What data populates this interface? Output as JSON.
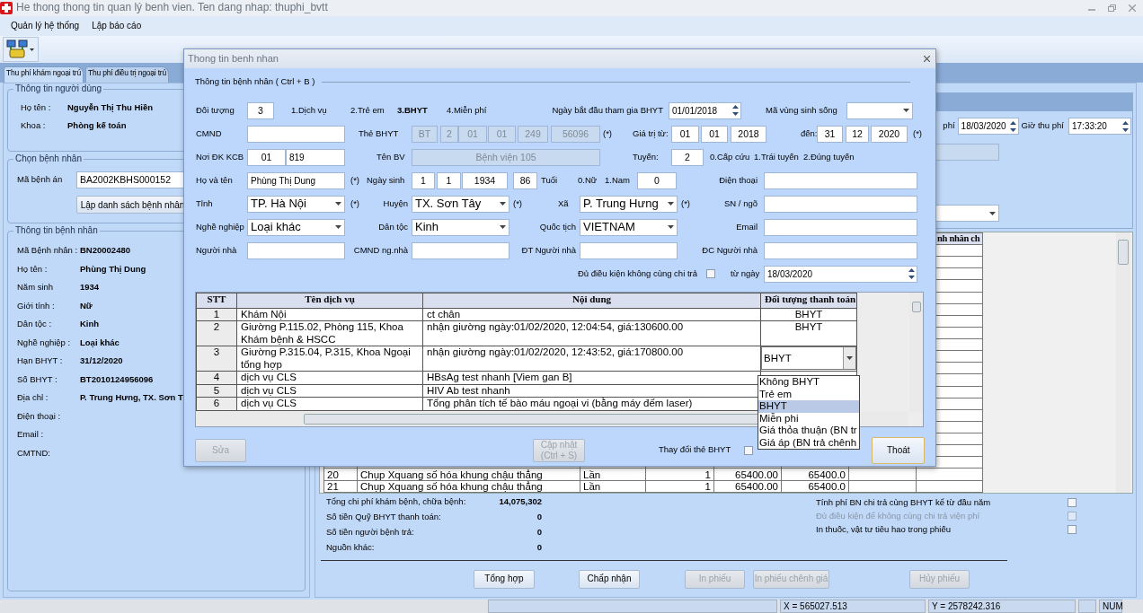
{
  "window": {
    "title": "He thong thong tin quan lý benh vien. Ten dang nhap: thuphi_bvtt"
  },
  "menu": [
    {
      "label": "Quản lý hệ thống"
    },
    {
      "label": "Lập báo cáo"
    }
  ],
  "tabs": [
    {
      "label": "Thu phí khám ngoại trú",
      "selected": true
    },
    {
      "label": "Thu phí điều trị ngoại trú",
      "selected": false
    }
  ],
  "user_info": {
    "title": "Thông tin người dùng",
    "fields": [
      {
        "label": "Họ tên :",
        "value": "Nguyễn Thị Thu Hiền"
      },
      {
        "label": "Khoa :",
        "value": "Phòng kế toán"
      }
    ]
  },
  "patient_select": {
    "title": "Chọn bệnh nhân",
    "label": "Mã bệnh án",
    "value": "BA2002KBHS000152",
    "button": "Lập danh sách bệnh nhân"
  },
  "patient_info": {
    "title": "Thông tin bệnh nhân",
    "fields": [
      {
        "label": "Mã Bệnh nhân :",
        "value": "BN20002480"
      },
      {
        "label": "Họ tên :",
        "value": "Phùng Thị Dung"
      },
      {
        "label": "Năm sinh",
        "value": "1934"
      },
      {
        "label": "Giới tính :",
        "value": "Nữ"
      },
      {
        "label": "Dân tộc :",
        "value": "Kinh"
      },
      {
        "label": "Nghề nghiệp :",
        "value": "Loại khác"
      },
      {
        "label": "Hạn BHYT :",
        "value": "31/12/2020"
      },
      {
        "label": "Số BHYT :",
        "value": "BT2010124956096"
      },
      {
        "label": "Địa chỉ :",
        "value": "P. Trung Hưng, TX. Sơn T"
      },
      {
        "label": "Điện thoại :"
      },
      {
        "label": "Email :"
      },
      {
        "label": "CMTND:"
      }
    ]
  },
  "fee_header": {
    "date_label": "phí",
    "date": "18/03/2020",
    "time_label": "Giờ thu phí",
    "time": "17:33:20"
  },
  "fee_grid": {
    "column_header": "nh nhân ch",
    "rows": [
      {
        "cells": [
          "20",
          "Chụp Xquang số hóa khung chậu thẳng",
          "Lần",
          "1",
          "65400.00",
          "65400.0"
        ]
      },
      {
        "cells": [
          "21",
          "Chụp Xquang số hóa khung chậu thẳng",
          "Lần",
          "1",
          "65400.00",
          "65400.0"
        ]
      }
    ]
  },
  "totals": [
    {
      "label": "Tổng chi phí khám bệnh, chữa bệnh:",
      "value": "14,075,302"
    },
    {
      "label": "Số tiền Quỹ BHYT thanh toán:",
      "value": "0"
    },
    {
      "label": "Số tiền người bệnh trả:",
      "value": "0"
    },
    {
      "label": "Nguồn khác:",
      "value": "0"
    }
  ],
  "options": [
    {
      "label": "Tính phí BN chi trả cùng BHYT kể từ đầu năm",
      "checked": false,
      "disabled": false
    },
    {
      "label": "Đủ điều kiện để không cùng chi trả viện phí",
      "checked": false,
      "disabled": true
    },
    {
      "label": "In thuốc, vật tư tiêu hao trong phiếu",
      "checked": false,
      "disabled": false
    }
  ],
  "actions": [
    {
      "label": "Tổng hợp",
      "disabled": false
    },
    {
      "label": "Chấp nhận",
      "disabled": false
    },
    {
      "label": "In phiếu",
      "disabled": true
    },
    {
      "label": "In phiếu chênh giá",
      "disabled": true
    },
    {
      "label": "Hủy phiếu",
      "disabled": true
    }
  ],
  "status_bar": {
    "x": "X = 565027.513",
    "y": "Y = 2578242.316",
    "keys": "NUM"
  },
  "dialog": {
    "title": "Thong tin benh nhan",
    "section": "Thông tin bệnh nhân ( Ctrl + B )",
    "lines": [
      {
        "items": [
          {
            "kind": "label",
            "text": "Đối tượng"
          },
          {
            "kind": "input",
            "value": "3"
          },
          {
            "kind": "note",
            "text": "1.Dịch vụ"
          },
          {
            "kind": "note",
            "text": "2.Trẻ em"
          },
          {
            "kind": "note",
            "text": "3.BHYT",
            "bold": true
          },
          {
            "kind": "note",
            "text": "4.Miễn phí"
          },
          {
            "kind": "label",
            "text": "Ngày bắt đầu tham gia BHYT"
          },
          {
            "kind": "spin",
            "value": "01/01/2018"
          },
          {
            "kind": "label",
            "text": "Mã vùng sinh sống"
          },
          {
            "kind": "select"
          }
        ]
      },
      {
        "items": [
          {
            "kind": "label",
            "text": "CMND"
          },
          {
            "kind": "input"
          },
          {
            "kind": "label",
            "text": "Thẻ BHYT"
          },
          {
            "kind": "input",
            "value": "BT",
            "disabled": true
          },
          {
            "kind": "input",
            "value": "2",
            "disabled": true
          },
          {
            "kind": "input",
            "value": "01",
            "disabled": true
          },
          {
            "kind": "input",
            "value": "01",
            "disabled": true
          },
          {
            "kind": "input",
            "value": "249",
            "disabled": true
          },
          {
            "kind": "input",
            "value": "56096",
            "disabled": true
          },
          {
            "kind": "note",
            "text": "(*)"
          },
          {
            "kind": "label",
            "text": "Giá trị từ:"
          },
          {
            "kind": "input",
            "value": "01"
          },
          {
            "kind": "input",
            "value": "01"
          },
          {
            "kind": "input",
            "value": "2018"
          },
          {
            "kind": "label",
            "text": "đến:"
          },
          {
            "kind": "input",
            "value": "31"
          },
          {
            "kind": "input",
            "value": "12"
          },
          {
            "kind": "input",
            "value": "2020"
          },
          {
            "kind": "note",
            "text": "(*)"
          }
        ]
      },
      {
        "items": [
          {
            "kind": "label",
            "text": "Nơi ĐK KCB"
          },
          {
            "kind": "input",
            "value": "01"
          },
          {
            "kind": "input",
            "value": "819"
          },
          {
            "kind": "label",
            "text": "Tên BV"
          },
          {
            "kind": "input",
            "value": "Bệnh viện 105",
            "disabled": true
          },
          {
            "kind": "label",
            "text": "Tuyến:"
          },
          {
            "kind": "input",
            "value": "2"
          },
          {
            "kind": "note",
            "text": "0.Cấp cứu"
          },
          {
            "kind": "note",
            "text": "1.Trái tuyến"
          },
          {
            "kind": "note",
            "text": "2.Đúng tuyến"
          }
        ]
      },
      {
        "items": [
          {
            "kind": "label",
            "text": "Họ và tên"
          },
          {
            "kind": "input",
            "value": "Phùng Thị Dung"
          },
          {
            "kind": "note",
            "text": "(*)"
          },
          {
            "kind": "label",
            "text": "Ngày sinh"
          },
          {
            "kind": "input",
            "value": "1"
          },
          {
            "kind": "input",
            "value": "1"
          },
          {
            "kind": "input",
            "value": "1934"
          },
          {
            "kind": "input",
            "value": "86"
          },
          {
            "kind": "note",
            "text": "Tuổi"
          },
          {
            "kind": "note",
            "text": "0.Nữ"
          },
          {
            "kind": "note",
            "text": "1.Nam"
          },
          {
            "kind": "input",
            "value": "0"
          },
          {
            "kind": "label",
            "text": "Điện thoại"
          },
          {
            "kind": "input"
          }
        ]
      },
      {
        "items": [
          {
            "kind": "label",
            "text": "Tỉnh"
          },
          {
            "kind": "select",
            "value": "TP. Hà Nội"
          },
          {
            "kind": "note",
            "text": "(*)"
          },
          {
            "kind": "label",
            "text": "Huyện"
          },
          {
            "kind": "select",
            "value": "TX. Sơn Tây"
          },
          {
            "kind": "note",
            "text": "(*)"
          },
          {
            "kind": "label",
            "text": "Xã"
          },
          {
            "kind": "select",
            "value": "P. Trung Hưng"
          },
          {
            "kind": "note",
            "text": "(*)"
          },
          {
            "kind": "label",
            "text": "SN / ngõ"
          },
          {
            "kind": "input"
          }
        ]
      },
      {
        "items": [
          {
            "kind": "label",
            "text": "Nghề nghiệp"
          },
          {
            "kind": "select",
            "value": "Loại khác"
          },
          {
            "kind": "label",
            "text": "Dân tộc"
          },
          {
            "kind": "select",
            "value": "Kinh"
          },
          {
            "kind": "label",
            "text": "Quốc tịch"
          },
          {
            "kind": "select",
            "value": "VIETNAM"
          },
          {
            "kind": "label",
            "text": "Email"
          },
          {
            "kind": "input"
          }
        ]
      },
      {
        "items": [
          {
            "kind": "label",
            "text": "Người nhà"
          },
          {
            "kind": "input"
          },
          {
            "kind": "label",
            "text": "CMND ng.nhà"
          },
          {
            "kind": "input"
          },
          {
            "kind": "label",
            "text": "ĐT Người nhà"
          },
          {
            "kind": "input"
          },
          {
            "kind": "label",
            "text": "ĐC Người nhà"
          },
          {
            "kind": "input"
          }
        ]
      },
      {
        "items": [
          {
            "kind": "label",
            "text": "Đủ điều kiện không cùng chi trả"
          },
          {
            "kind": "check",
            "checked": false
          },
          {
            "kind": "label",
            "text": "từ ngày"
          },
          {
            "kind": "spin",
            "value": "18/03/2020"
          }
        ]
      }
    ],
    "services": {
      "columns": [
        "STT",
        "Tên dịch vụ",
        "Nội dung",
        "Đối tượng thanh toán"
      ],
      "rows": [
        {
          "kind": "text",
          "stt": "1",
          "service": "Khám Nội",
          "content": "ct chân",
          "payment": "BHYT"
        },
        {
          "kind": "text",
          "stt": "2",
          "service": "Giường P.115.02, Phòng 115, Khoa Khám bệnh & HSCC",
          "content": "nhận giường ngày:01/02/2020, 12:04:54, giá:130600.00",
          "payment": "BHYT"
        },
        {
          "kind": "combo",
          "stt": "3",
          "service": "Giường P.315.04, P.315, Khoa Ngoại tổng hợp",
          "content": "nhận giường ngày:01/02/2020, 12:43:52, giá:170800.00",
          "payment": "BHYT"
        },
        {
          "kind": "text",
          "stt": "4",
          "service": "dịch vụ CLS",
          "content": "HBsAg test nhanh [Viem gan B]"
        },
        {
          "kind": "text",
          "stt": "5",
          "service": "dịch vụ CLS",
          "content": "HIV Ab test nhanh"
        },
        {
          "kind": "text",
          "stt": "6",
          "service": "dịch vụ CLS",
          "content": "Tổng phân tích tế bào máu ngoại vi (bằng máy đếm laser)"
        }
      ]
    },
    "payment_options": [
      {
        "label": "Không BHYT",
        "selected": false
      },
      {
        "label": "Trẻ em",
        "selected": false
      },
      {
        "label": "BHYT",
        "selected": true
      },
      {
        "label": "Miễn phi",
        "selected": false
      },
      {
        "label": "Giá thỏa thuận (BN tr",
        "selected": false
      },
      {
        "label": "Giá áp (BN trả chênh",
        "selected": false
      }
    ],
    "buttons": [
      {
        "label": "Sửa",
        "disabled": true
      },
      {
        "label": "Cập nhật\n(Ctrl + S)",
        "disabled": true
      }
    ],
    "change_card": {
      "label": "Thay đổi thẻ BHYT",
      "checked": false
    },
    "close_button": {
      "label": "Thoát",
      "disabled": false
    }
  }
}
